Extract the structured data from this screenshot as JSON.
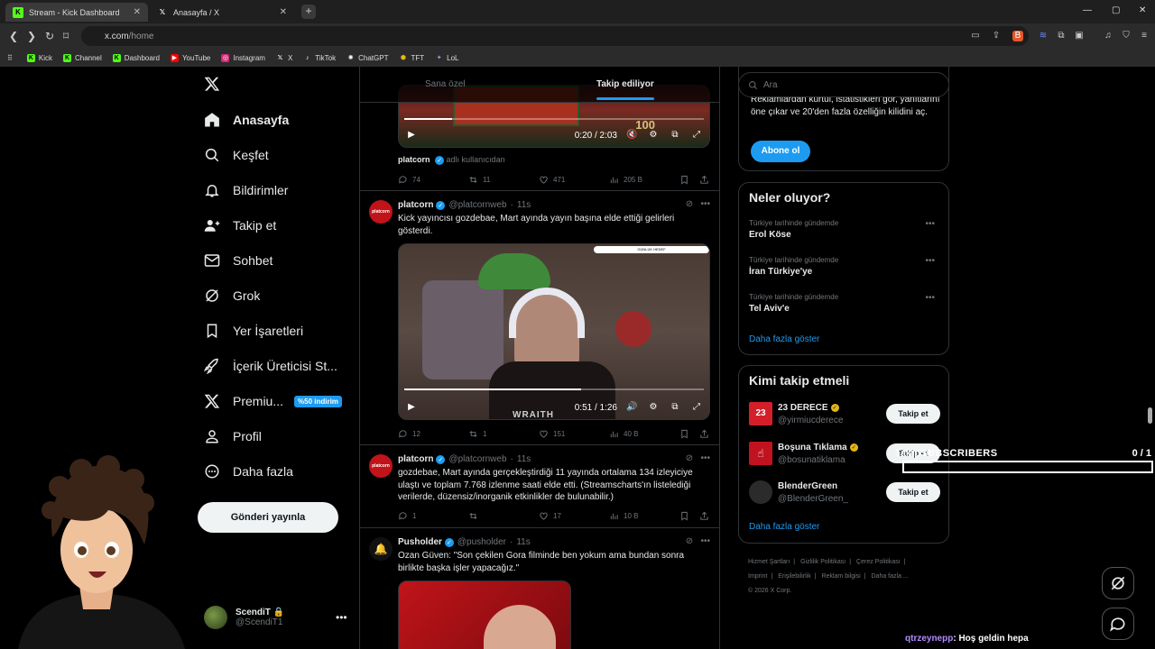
{
  "browser": {
    "tabs": [
      {
        "label": "Stream - Kick Dashboard",
        "icon": "kick-icon",
        "active": true
      },
      {
        "label": "Anasayfa / X",
        "icon": "x-logo-icon",
        "active": false
      }
    ],
    "url_domain": "x.com",
    "url_path": "/home",
    "bookmarks": [
      "Kick",
      "Channel",
      "Dashboard",
      "YouTube",
      "Instagram",
      "X",
      "TikTok",
      "ChatGPT",
      "TFT",
      "LoL"
    ]
  },
  "nav": {
    "items": [
      {
        "label": "Anasayfa",
        "icon": "home-icon"
      },
      {
        "label": "Keşfet",
        "icon": "search-icon"
      },
      {
        "label": "Bildirimler",
        "icon": "bell-icon"
      },
      {
        "label": "Takip et",
        "icon": "person-add-icon"
      },
      {
        "label": "Sohbet",
        "icon": "mail-icon"
      },
      {
        "label": "Grok",
        "icon": "grok-icon"
      },
      {
        "label": "Yer İşaretleri",
        "icon": "bookmark-icon"
      },
      {
        "label": "İçerik Üreticisi St...",
        "icon": "rocket-icon"
      },
      {
        "label": "Premiu...",
        "icon": "x-logo-icon"
      },
      {
        "label": "Profil",
        "icon": "person-icon"
      },
      {
        "label": "Daha fazla",
        "icon": "more-circle-icon"
      }
    ],
    "premium_badge": "%50 indirim",
    "post_button": "Gönderi yayınla",
    "account": {
      "name": "ScendiT",
      "handle": "@ScendiT1"
    }
  },
  "feed": {
    "tabs": [
      "Sana özel",
      "Takip ediliyor"
    ],
    "top_video": {
      "time": "0:20 / 2:03",
      "score": "100"
    },
    "top_source": "adlı kullanıcıdan",
    "top_author": "platcorn",
    "top_actions": {
      "replies": "74",
      "reposts": "11",
      "likes": "471",
      "views": "205 B"
    },
    "tweets": [
      {
        "name": "platcorn",
        "handle": "@platcornweb",
        "time": "11s",
        "text": "Kick yayıncısı gozdebae, Mart ayında yayın başına elde ettiği gelirleri gösterdi.",
        "video_time": "0:51 / 1:26",
        "video_progress": 0.59,
        "video_overlay": "GÜNLÜK HEDEF",
        "video_watermark": "WRAITH",
        "replies": "12",
        "reposts": "1",
        "likes": "151",
        "views": "40 B"
      },
      {
        "name": "platcorn",
        "handle": "@platcornweb",
        "time": "11s",
        "text": "gozdebae, Mart ayında gerçekleştirdiği 11 yayında ortalama 134 izleyiciye ulaştı ve toplam 7.768 izlenme saati elde etti. (Streamscharts'ın listelediği verilerde, düzensiz/inorganik etkinlikler de bulunabilir.)",
        "replies": "1",
        "reposts": "",
        "likes": "17",
        "views": "10 B"
      },
      {
        "name": "Pusholder",
        "handle": "@pusholder",
        "time": "11s",
        "text": "Ozan Güven: \"Son çekilen Gora filminde ben yokum ama bundan sonra birlikte başka işler yapacağız.\""
      }
    ]
  },
  "right": {
    "search_placeholder": "Ara",
    "premium_text": "Reklamlardan kurtul, istatistikleri gör, yanıtlarını öne çıkar ve 20'den fazla özelliğin kilidini aç.",
    "subscribe_button": "Abone ol",
    "trends_title": "Neler oluyor?",
    "trends": [
      {
        "context": "Türkiye tarihinde gündemde",
        "title": "Erol Köse"
      },
      {
        "context": "Türkiye tarihinde gündemde",
        "title": "İran Türkiye'ye"
      },
      {
        "context": "Türkiye tarihinde gündemde",
        "title": "Tel Aviv'e"
      }
    ],
    "show_more": "Daha fazla göster",
    "wtf_title": "Kimi takip etmeli",
    "wtf": [
      {
        "name": "23 DERECE",
        "handle": "@yirmiucderece",
        "avatar_color": "#d41f2a"
      },
      {
        "name": "Boşuna Tıklama",
        "handle": "@bosunatiklama",
        "avatar_color": "#c1121f"
      },
      {
        "name": "BlenderGreen",
        "handle": "@BlenderGreen_",
        "avatar_color": "#3a3a3a"
      }
    ],
    "follow_label": "Takip et",
    "wtf_show_more": "Daha fazla göster",
    "footer": [
      "Hizmet Şartları",
      "|",
      "Gizlilik Politikası",
      "|",
      "Çerez Politikası",
      "|",
      "Imprint",
      "|",
      "Erişilebilirlik",
      "|",
      "Reklam bilgisi",
      "|",
      "Daha fazla ...",
      "© 2026 X Corp."
    ]
  },
  "overlay": {
    "subs_label": "SUBSCRIBERS",
    "subs_count": "0 / 1",
    "subs_follow_fragment": "Takip et",
    "chat_user": "qtrzeynepp",
    "chat_text": ": Hoş geldin hepa"
  },
  "colors": {
    "accent": "#1d9bf0",
    "background": "#000000",
    "border": "#2f3336",
    "muted": "#71767b"
  }
}
